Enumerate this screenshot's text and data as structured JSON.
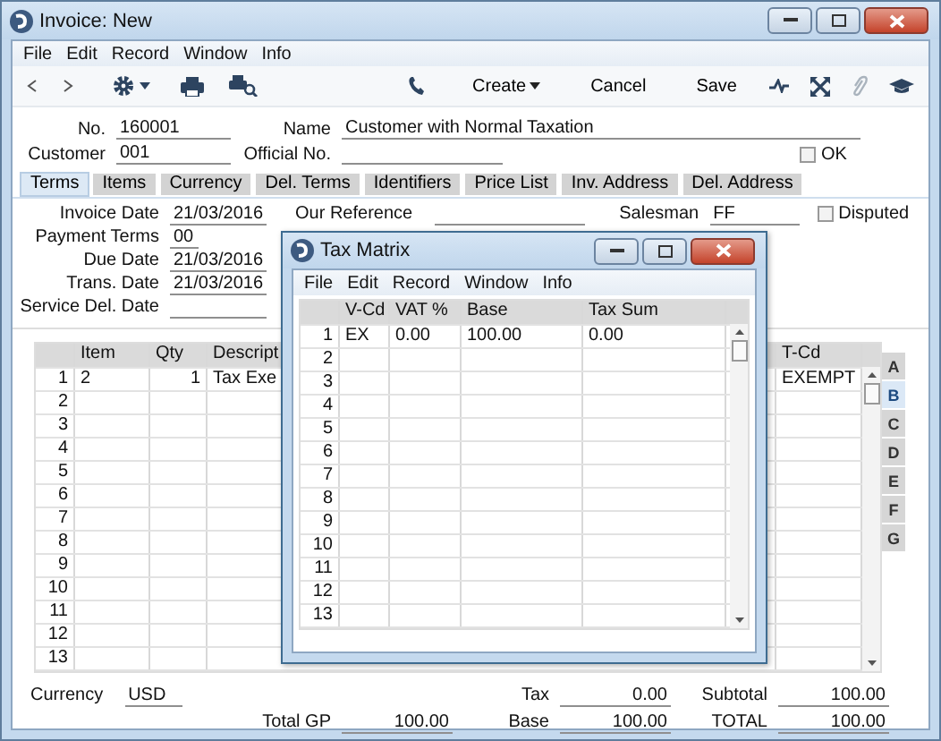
{
  "window": {
    "title": "Invoice: New"
  },
  "menu": [
    "File",
    "Edit",
    "Record",
    "Window",
    "Info"
  ],
  "toolbar": {
    "create": "Create",
    "cancel": "Cancel",
    "save": "Save"
  },
  "header": {
    "no": {
      "label": "No.",
      "value": "160001"
    },
    "name": {
      "label": "Name",
      "value": "Customer with Normal Taxation"
    },
    "customer": {
      "label": "Customer",
      "value": "001"
    },
    "official_no": {
      "label": "Official No."
    },
    "ok": {
      "label": "OK",
      "checked": false
    }
  },
  "tabs": [
    {
      "label": "Terms",
      "selected": true
    },
    {
      "label": "Items",
      "selected": false
    },
    {
      "label": "Currency",
      "selected": false
    },
    {
      "label": "Del. Terms",
      "selected": false
    },
    {
      "label": "Identifiers",
      "selected": false
    },
    {
      "label": "Price List",
      "selected": false
    },
    {
      "label": "Inv. Address",
      "selected": false
    },
    {
      "label": "Del. Address",
      "selected": false
    }
  ],
  "terms": {
    "fields": [
      {
        "label": "Invoice Date",
        "value": "21/03/2016",
        "kind": "date"
      },
      {
        "label": "Payment Terms",
        "value": "00",
        "kind": "code"
      },
      {
        "label": "Due Date",
        "value": "21/03/2016",
        "kind": "date"
      },
      {
        "label": "Trans. Date",
        "value": "21/03/2016",
        "kind": "date"
      },
      {
        "label": "Service Del. Date",
        "kind": "date"
      }
    ],
    "our_reference": {
      "label": "Our Reference"
    },
    "salesman": {
      "label": "Salesman",
      "value": "FF"
    },
    "disputed": {
      "label": "Disputed",
      "checked": false
    }
  },
  "items_table": {
    "columns": [
      "Item",
      "Qty",
      "Descript",
      "T-Cd"
    ],
    "rows": [
      {
        "no": "1",
        "cells": [
          "2",
          "1",
          "Tax Exe",
          "EXEMPT"
        ]
      },
      {
        "no": "2"
      },
      {
        "no": "3"
      },
      {
        "no": "4"
      },
      {
        "no": "5"
      },
      {
        "no": "6"
      },
      {
        "no": "7"
      },
      {
        "no": "8"
      },
      {
        "no": "9"
      },
      {
        "no": "10"
      },
      {
        "no": "11"
      },
      {
        "no": "12"
      },
      {
        "no": "13"
      }
    ]
  },
  "side_tabs": [
    {
      "label": "A",
      "selected": false
    },
    {
      "label": "B",
      "selected": true
    },
    {
      "label": "C",
      "selected": false
    },
    {
      "label": "D",
      "selected": false
    },
    {
      "label": "E",
      "selected": false
    },
    {
      "label": "F",
      "selected": false
    },
    {
      "label": "G",
      "selected": false
    }
  ],
  "footer": {
    "currency": {
      "label": "Currency",
      "value": "USD"
    },
    "rows": [
      {
        "fields": [
          {
            "label": "Tax",
            "value": "0.00"
          },
          {
            "label": "Subtotal",
            "value": "100.00"
          }
        ]
      },
      {
        "fields": [
          {
            "label": "Total GP",
            "value": "100.00"
          },
          {
            "label": "Base",
            "value": "100.00"
          },
          {
            "label": "TOTAL",
            "value": "100.00"
          }
        ]
      }
    ]
  },
  "tax_matrix": {
    "title": "Tax Matrix",
    "menu": [
      "File",
      "Edit",
      "Record",
      "Window",
      "Info"
    ],
    "columns": [
      "V-Cd",
      "VAT %",
      "Base",
      "Tax Sum"
    ],
    "rows": [
      {
        "no": "1",
        "cells": [
          "EX",
          "0.00",
          "100.00",
          "0.00"
        ]
      },
      {
        "no": "2"
      },
      {
        "no": "3"
      },
      {
        "no": "4"
      },
      {
        "no": "5"
      },
      {
        "no": "6"
      },
      {
        "no": "7"
      },
      {
        "no": "8"
      },
      {
        "no": "9"
      },
      {
        "no": "10"
      },
      {
        "no": "11"
      },
      {
        "no": "12"
      },
      {
        "no": "13"
      }
    ]
  }
}
